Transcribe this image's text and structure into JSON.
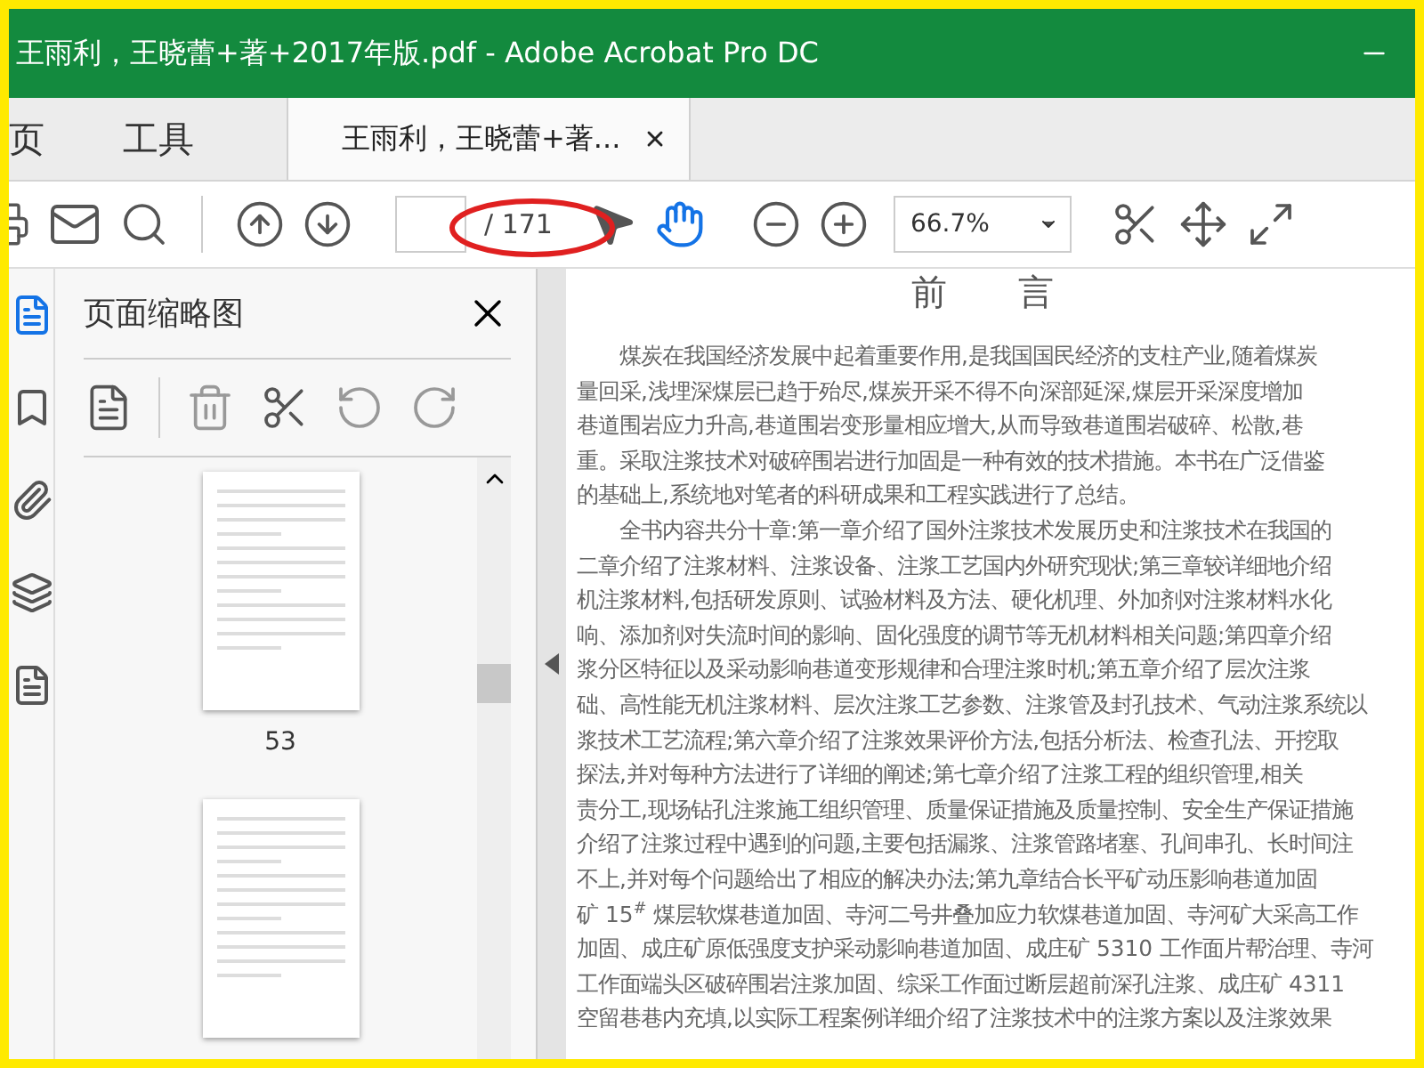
{
  "window": {
    "title": "王雨利，王晓蕾+著+2017年版.pdf - Adobe Acrobat Pro DC"
  },
  "tabs": [
    {
      "kind": "home",
      "label": "页",
      "selected": false
    },
    {
      "kind": "home",
      "label": "工具",
      "selected": false
    },
    {
      "kind": "document",
      "label": "王雨利，王晓蕾+著...",
      "selected": true
    }
  ],
  "toolbar": {
    "page_total": "/ 171",
    "zoom": "66.7%",
    "tools": [
      {
        "kind": "select",
        "selected": false
      },
      {
        "kind": "hand",
        "selected": true
      }
    ]
  },
  "sidebar": {
    "title": "页面缩略图",
    "thumbnail_labels": [
      "53"
    ]
  },
  "document": {
    "heading": "前　　言",
    "paragraphs": [
      [
        "煤炭在我国经济发展中起着重要作用,是我国国民经济的支柱产业,随着煤炭",
        "量回采,浅埋深煤层已趋于殆尽,煤炭开采不得不向深部延深,煤层开采深度增加",
        "巷道围岩应力升高,巷道围岩变形量相应增大,从而导致巷道围岩破碎、松散,巷",
        "重。采取注浆技术对破碎围岩进行加固是一种有效的技术措施。本书在广泛借鉴",
        "的基础上,系统地对笔者的科研成果和工程实践进行了总结。"
      ],
      [
        "全书内容共分十章:第一章介绍了国外注浆技术发展历史和注浆技术在我国的",
        "二章介绍了注浆材料、注浆设备、注浆工艺国内外研究现状;第三章较详细地介绍",
        "机注浆材料,包括研发原则、试验材料及方法、硬化机理、外加剂对注浆材料水化",
        "响、添加剂对失流时间的影响、固化强度的调节等无机材料相关问题;第四章介绍",
        "浆分区特征以及采动影响巷道变形规律和合理注浆时机;第五章介绍了层次注浆",
        "础、高性能无机注浆材料、层次注浆工艺参数、注浆管及封孔技术、气动注浆系统以",
        "浆技术工艺流程;第六章介绍了注浆效果评价方法,包括分析法、检查孔法、开挖取",
        "探法,并对每种方法进行了详细的阐述;第七章介绍了注浆工程的组织管理,相关",
        "责分工,现场钻孔注浆施工组织管理、质量保证措施及质量控制、安全生产保证措施",
        "介绍了注浆过程中遇到的问题,主要包括漏浆、注浆管路堵塞、孔间串孔、长时间注",
        "不上,并对每个问题给出了相应的解决办法;第九章结合长平矿动压影响巷道加固",
        "矿 15$^{#}$ 煤层软煤巷道加固、寺河二号井叠加应力软煤巷道加固、寺河矿大采高工作",
        "加固、成庄矿原低强度支护采动影响巷道加固、成庄矿 5310 工作面片帮治理、寺河",
        "工作面端头区破碎围岩注浆加固、综采工作面过断层超前深孔注浆、成庄矿 4311",
        "空留巷巷内充填,以实际工程案例详细介绍了注浆技术中的注浆方案以及注浆效果"
      ]
    ]
  }
}
